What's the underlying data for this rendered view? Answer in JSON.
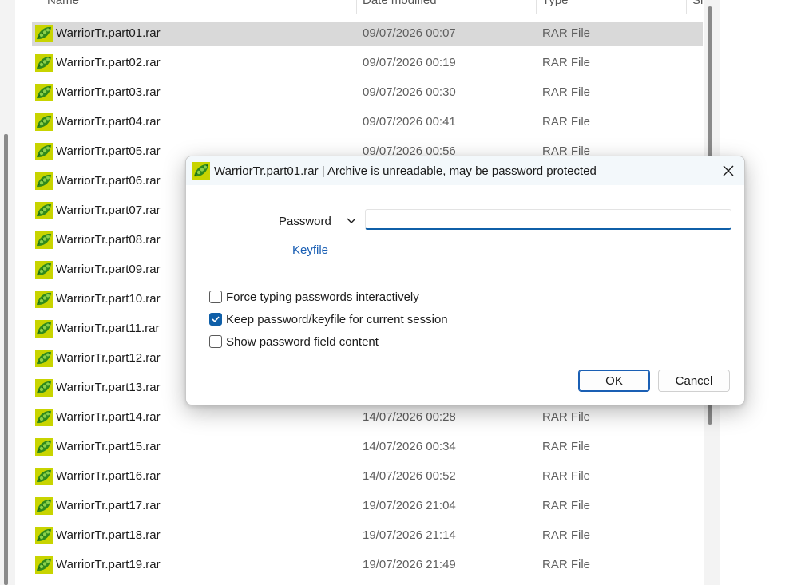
{
  "columns": {
    "name": "Name",
    "date": "Date modified",
    "type": "Type",
    "size": "Si"
  },
  "files": [
    {
      "name": "WarriorTr.part01.rar",
      "date": "09/07/2026 00:07",
      "type": "RAR File",
      "selected": true
    },
    {
      "name": "WarriorTr.part02.rar",
      "date": "09/07/2026 00:19",
      "type": "RAR File"
    },
    {
      "name": "WarriorTr.part03.rar",
      "date": "09/07/2026 00:30",
      "type": "RAR File"
    },
    {
      "name": "WarriorTr.part04.rar",
      "date": "09/07/2026 00:41",
      "type": "RAR File"
    },
    {
      "name": "WarriorTr.part05.rar",
      "date": "09/07/2026 00:56",
      "type": "RAR File"
    },
    {
      "name": "WarriorTr.part06.rar",
      "date": "",
      "type": ""
    },
    {
      "name": "WarriorTr.part07.rar",
      "date": "",
      "type": ""
    },
    {
      "name": "WarriorTr.part08.rar",
      "date": "",
      "type": ""
    },
    {
      "name": "WarriorTr.part09.rar",
      "date": "",
      "type": ""
    },
    {
      "name": "WarriorTr.part10.rar",
      "date": "",
      "type": ""
    },
    {
      "name": "WarriorTr.part11.rar",
      "date": "",
      "type": ""
    },
    {
      "name": "WarriorTr.part12.rar",
      "date": "",
      "type": ""
    },
    {
      "name": "WarriorTr.part13.rar",
      "date": "",
      "type": ""
    },
    {
      "name": "WarriorTr.part14.rar",
      "date": "14/07/2026 00:28",
      "type": "RAR File"
    },
    {
      "name": "WarriorTr.part15.rar",
      "date": "14/07/2026 00:34",
      "type": "RAR File"
    },
    {
      "name": "WarriorTr.part16.rar",
      "date": "14/07/2026 00:52",
      "type": "RAR File"
    },
    {
      "name": "WarriorTr.part17.rar",
      "date": "19/07/2026 21:04",
      "type": "RAR File"
    },
    {
      "name": "WarriorTr.part18.rar",
      "date": "19/07/2026 21:14",
      "type": "RAR File"
    },
    {
      "name": "WarriorTr.part19.rar",
      "date": "19/07/2026 21:49",
      "type": "RAR File"
    }
  ],
  "file_icon": "peazip-pea-icon",
  "dialog": {
    "title": "WarriorTr.part01.rar | Archive is unreadable, may be password protected",
    "password_label": "Password",
    "password_value": "",
    "keyfile_label": "Keyfile",
    "options": [
      {
        "label": "Force typing passwords interactively",
        "checked": false
      },
      {
        "label": "Keep password/keyfile for current session",
        "checked": true
      },
      {
        "label": "Show password field content",
        "checked": false
      }
    ],
    "ok_label": "OK",
    "cancel_label": "Cancel"
  },
  "colors": {
    "accent": "#0f5fa8",
    "link": "#1a5fb4",
    "selection": "#d9d9d9"
  }
}
